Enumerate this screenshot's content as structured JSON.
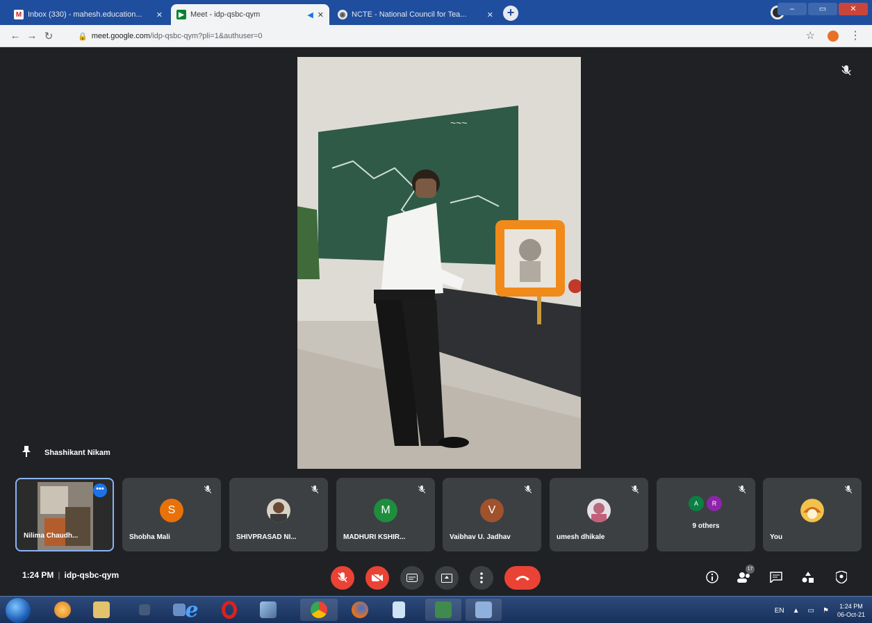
{
  "browser": {
    "tabs": [
      {
        "title": "Inbox (330) - mahesh.education...",
        "icon": "gmail-icon",
        "active": false
      },
      {
        "title": "Meet - idp-qsbc-qym",
        "icon": "meet-icon",
        "active": true
      },
      {
        "title": "NCTE - National Council for Tea...",
        "icon": "ncte-icon",
        "active": false
      }
    ],
    "new_tab_label": "+",
    "url_host": "meet.google.com",
    "url_path": "/idp-qsbc-qym?pli=1&authuser=0"
  },
  "meeting": {
    "active_speaker": "Shashikant Nikam",
    "time": "1:24 PM",
    "code": "idp-qsbc-qym"
  },
  "participants": [
    {
      "name": "Nilima Chaudh...",
      "kind": "video",
      "self_view": true
    },
    {
      "name": "Shobha Mali",
      "kind": "letter",
      "initial": "S",
      "color": "#e8710a"
    },
    {
      "name": "SHIVPRASAD NI...",
      "kind": "photo"
    },
    {
      "name": "MADHURI KSHIR...",
      "kind": "letter",
      "initial": "M",
      "color": "#1e8e3e"
    },
    {
      "name": "Vaibhav U. Jadhav",
      "kind": "letter",
      "initial": "V",
      "color": "#a0522d"
    },
    {
      "name": "umesh dhikale",
      "kind": "photo"
    },
    {
      "name": "9 others",
      "kind": "group",
      "initials": [
        "A",
        "R"
      ],
      "colors": [
        "#0b8043",
        "#8e24aa"
      ]
    },
    {
      "name": "You",
      "kind": "photo"
    }
  ],
  "controls": {
    "mic": "mic-off",
    "camera": "camera-off",
    "captions": "captions",
    "present": "present-now",
    "more": "more-options",
    "end": "end-call",
    "info": "meeting-details",
    "people_count": "17",
    "chat": "chat",
    "activities": "activities",
    "host": "host-controls"
  },
  "taskbar": {
    "language": "EN",
    "time": "1:24 PM",
    "date": "06-Oct-21"
  },
  "colors": {
    "meet_bg": "#202124",
    "tile_bg": "#3c4043",
    "danger": "#ea4335",
    "self_border": "#8ab4f8"
  }
}
